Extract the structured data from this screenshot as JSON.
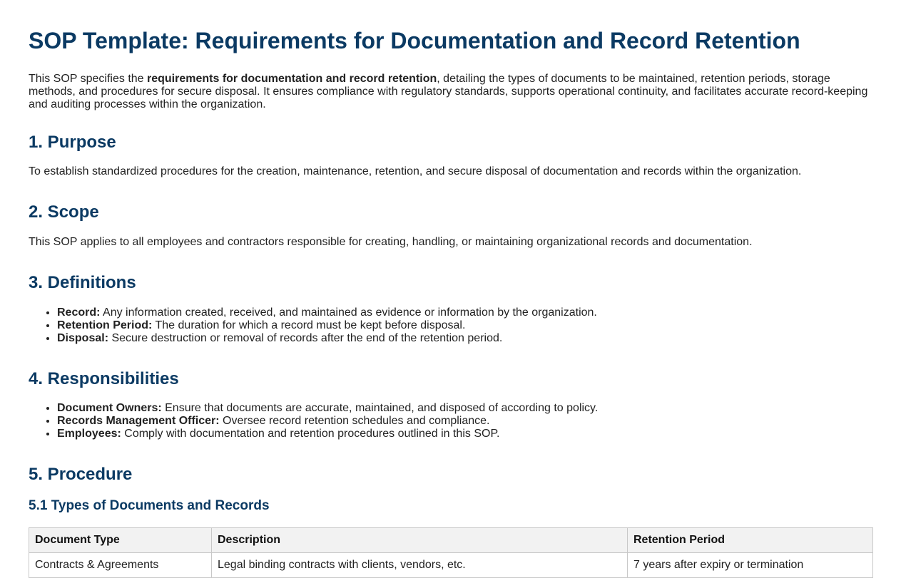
{
  "title": "SOP Template: Requirements for Documentation and Record Retention",
  "intro": {
    "before": "This SOP specifies the ",
    "bold": "requirements for documentation and record retention",
    "after": ", detailing the types of documents to be maintained, retention periods, storage methods, and procedures for secure disposal. It ensures compliance with regulatory standards, supports operational continuity, and facilitates accurate record-keeping and auditing processes within the organization."
  },
  "sections": {
    "purpose": {
      "heading": "1. Purpose",
      "text": "To establish standardized procedures for the creation, maintenance, retention, and secure disposal of documentation and records within the organization."
    },
    "scope": {
      "heading": "2. Scope",
      "text": "This SOP applies to all employees and contractors responsible for creating, handling, or maintaining organizational records and documentation."
    },
    "definitions": {
      "heading": "3. Definitions",
      "items": [
        {
          "term": "Record:",
          "text": " Any information created, received, and maintained as evidence or information by the organization."
        },
        {
          "term": "Retention Period:",
          "text": " The duration for which a record must be kept before disposal."
        },
        {
          "term": "Disposal:",
          "text": " Secure destruction or removal of records after the end of the retention period."
        }
      ]
    },
    "responsibilities": {
      "heading": "4. Responsibilities",
      "items": [
        {
          "term": "Document Owners:",
          "text": " Ensure that documents are accurate, maintained, and disposed of according to policy."
        },
        {
          "term": "Records Management Officer:",
          "text": " Oversee record retention schedules and compliance."
        },
        {
          "term": "Employees:",
          "text": " Comply with documentation and retention procedures outlined in this SOP."
        }
      ]
    },
    "procedure": {
      "heading": "5. Procedure",
      "sub_heading": "5.1 Types of Documents and Records",
      "table": {
        "headers": [
          "Document Type",
          "Description",
          "Retention Period"
        ],
        "rows": [
          [
            "Contracts & Agreements",
            "Legal binding contracts with clients, vendors, etc.",
            "7 years after expiry or termination"
          ]
        ]
      }
    }
  },
  "colors": {
    "heading": "#0b3a63",
    "table_header_bg": "#f2f2f2",
    "table_border": "#c8c8c8"
  }
}
